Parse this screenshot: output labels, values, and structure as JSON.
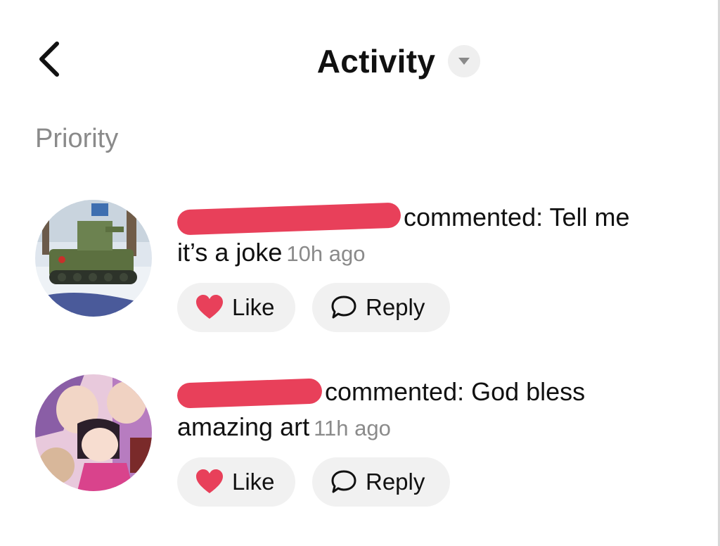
{
  "header": {
    "back_icon": "chevron-left-icon",
    "title": "Activity",
    "dropdown_icon": "caret-down-icon"
  },
  "section": {
    "label": "Priority"
  },
  "notifications": [
    {
      "action": "commented: Tell me",
      "comment_cont": "it’s a joke",
      "time": "10h ago",
      "like_label": "Like",
      "reply_label": "Reply",
      "like_icon": "heart-icon",
      "reply_icon": "speech-bubble-icon"
    },
    {
      "action": "commented: God bless",
      "comment_cont": "amazing art",
      "time": "11h ago",
      "like_label": "Like",
      "reply_label": "Reply",
      "like_icon": "heart-icon",
      "reply_icon": "speech-bubble-icon"
    }
  ],
  "colors": {
    "heart": "#e8405a",
    "redaction": "#e8405a",
    "muted_text": "#8a8a8a",
    "pill_bg": "#f1f1f1"
  }
}
